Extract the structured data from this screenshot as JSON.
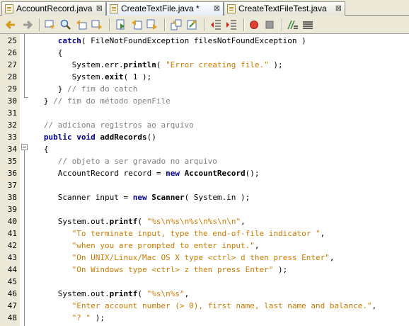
{
  "tabs": [
    {
      "label": "AccountRecord.java",
      "close": "⊠"
    },
    {
      "label": "CreateTextFile.java *",
      "close": "⊠"
    },
    {
      "label": "CreateTextFileTest.java",
      "close": "⊠"
    }
  ],
  "toolbar": {
    "icons": [
      "back-icon",
      "forward-icon",
      "toggle-bookmark-icon",
      "find-icon",
      "previous-bookmark-icon",
      "next-bookmark-icon",
      "find-selection-icon",
      "previous-occurrence-icon",
      "next-occurrence-icon",
      "toggle-highlight-icon",
      "shift-left-icon",
      "shift-right-icon",
      "start-macro-icon",
      "stop-macro-icon",
      "uncomment-icon",
      "comment-icon"
    ]
  },
  "editor": {
    "lines": [
      {
        "n": "25",
        "indent": "      ",
        "t": [
          [
            "kw",
            "catch"
          ],
          [
            "",
            "( FileNotFoundException filesNotFoundException )"
          ]
        ]
      },
      {
        "n": "26",
        "indent": "      ",
        "t": [
          [
            "",
            "{"
          ]
        ]
      },
      {
        "n": "27",
        "indent": "         ",
        "t": [
          [
            "",
            "System.err."
          ],
          [
            "b",
            "println"
          ],
          [
            "",
            "( "
          ],
          [
            "str",
            "\"Error creating file.\""
          ],
          [
            "",
            " );"
          ]
        ]
      },
      {
        "n": "28",
        "indent": "         ",
        "t": [
          [
            "",
            "System."
          ],
          [
            "b",
            "exit"
          ],
          [
            "",
            "( 1 );"
          ]
        ]
      },
      {
        "n": "29",
        "indent": "      ",
        "t": [
          [
            "",
            "} "
          ],
          [
            "cm",
            "// fim do catch"
          ]
        ]
      },
      {
        "n": "30",
        "indent": "   ",
        "t": [
          [
            "",
            "} "
          ],
          [
            "cm",
            "// fim do método openFile"
          ]
        ]
      },
      {
        "n": "31",
        "indent": "",
        "t": []
      },
      {
        "n": "32",
        "indent": "   ",
        "t": [
          [
            "cm",
            "// adiciona registros ao arquivo"
          ]
        ]
      },
      {
        "n": "33",
        "indent": "   ",
        "t": [
          [
            "kw",
            "public void "
          ],
          [
            "b",
            "addRecords"
          ],
          [
            "",
            "()"
          ]
        ]
      },
      {
        "n": "34",
        "indent": "   ",
        "t": [
          [
            "",
            "{"
          ]
        ]
      },
      {
        "n": "35",
        "indent": "      ",
        "t": [
          [
            "cm",
            "// objeto a ser gravado no arquivo"
          ]
        ]
      },
      {
        "n": "36",
        "indent": "      ",
        "t": [
          [
            "",
            "AccountRecord record = "
          ],
          [
            "kw",
            "new "
          ],
          [
            "b",
            "AccountRecord"
          ],
          [
            "",
            "();"
          ]
        ]
      },
      {
        "n": "37",
        "indent": "",
        "t": []
      },
      {
        "n": "38",
        "indent": "      ",
        "t": [
          [
            "",
            "Scanner input = "
          ],
          [
            "kw",
            "new "
          ],
          [
            "b",
            "Scanner"
          ],
          [
            "",
            "( System.in );"
          ]
        ]
      },
      {
        "n": "39",
        "indent": "",
        "t": []
      },
      {
        "n": "40",
        "indent": "      ",
        "t": [
          [
            "",
            "System.out."
          ],
          [
            "b",
            "printf"
          ],
          [
            "",
            "( "
          ],
          [
            "str",
            "\"%s\\n%s\\n%s\\n%s\\n\\n\""
          ],
          [
            "",
            ","
          ]
        ]
      },
      {
        "n": "41",
        "indent": "         ",
        "t": [
          [
            "str",
            "\"To terminate input, type the end-of-file indicator \""
          ],
          [
            "",
            ","
          ]
        ]
      },
      {
        "n": "42",
        "indent": "         ",
        "t": [
          [
            "str",
            "\"when you are prompted to enter input.\""
          ],
          [
            "",
            ","
          ]
        ]
      },
      {
        "n": "43",
        "indent": "         ",
        "t": [
          [
            "str",
            "\"On UNIX/Linux/Mac OS X type <ctrl> d then press Enter\""
          ],
          [
            "",
            ","
          ]
        ]
      },
      {
        "n": "44",
        "indent": "         ",
        "t": [
          [
            "str",
            "\"On Windows type <ctrl> z then press Enter\""
          ],
          [
            "",
            " );"
          ]
        ]
      },
      {
        "n": "45",
        "indent": "",
        "t": []
      },
      {
        "n": "46",
        "indent": "      ",
        "t": [
          [
            "",
            "System.out."
          ],
          [
            "b",
            "printf"
          ],
          [
            "",
            "( "
          ],
          [
            "str",
            "\"%s\\n%s\""
          ],
          [
            "",
            ","
          ]
        ]
      },
      {
        "n": "47",
        "indent": "         ",
        "t": [
          [
            "str",
            "\"Enter account number (> 0), first name, last name and balance.\""
          ],
          [
            "",
            ","
          ]
        ]
      },
      {
        "n": "48",
        "indent": "         ",
        "t": [
          [
            "str",
            "\"? \""
          ],
          [
            "",
            " );"
          ]
        ]
      }
    ]
  }
}
